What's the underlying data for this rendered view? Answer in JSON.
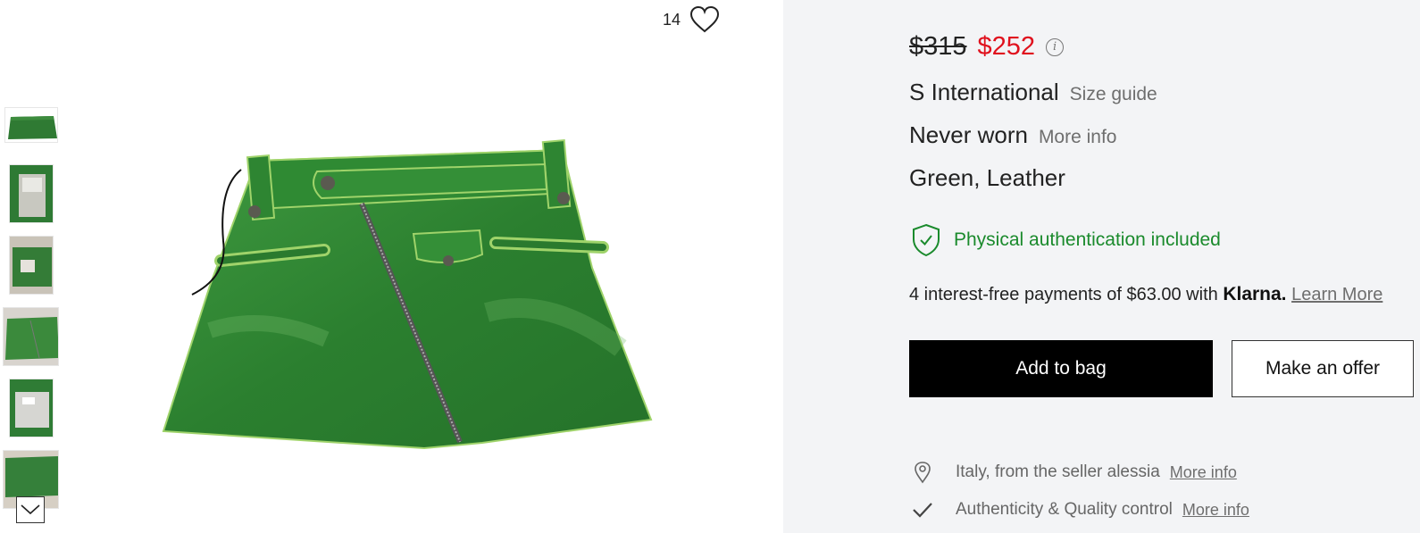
{
  "gallery": {
    "favorite_count": "14",
    "heart_icon": "heart-outline-icon",
    "thumbnails": 6,
    "scroll_icon": "chevron-down-icon"
  },
  "product": {
    "old_price": "$315",
    "new_price": "$252",
    "info_icon": "info-icon",
    "size": "S International",
    "size_guide": "Size guide",
    "condition": "Never worn",
    "condition_link": "More info",
    "attributes": "Green, Leather",
    "authentication": "Physical authentication included",
    "colors": {
      "sale": "#e0121e",
      "auth": "#1a8a2c",
      "primary_button": "#000000"
    }
  },
  "klarna": {
    "text": "4 interest-free payments of $63.00 with",
    "logo": "Klarna.",
    "link": "Learn More"
  },
  "actions": {
    "add_to_bag": "Add to bag",
    "make_offer": "Make an offer"
  },
  "details": [
    {
      "icon": "location-pin-icon",
      "text": "Italy, from the seller alessia",
      "link": "More info"
    },
    {
      "icon": "checkmark-icon",
      "text": "Authenticity & Quality control",
      "link": "More info"
    }
  ]
}
